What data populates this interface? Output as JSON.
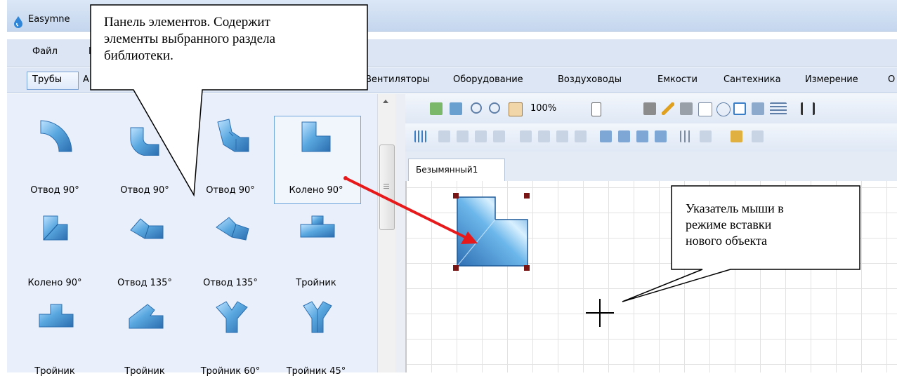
{
  "window": {
    "title_partial": "Easymne"
  },
  "menu": {
    "file": "Файл",
    "partial": "П"
  },
  "categories": {
    "active": "Трубы",
    "partial": "А",
    "items": [
      {
        "label": "Вентиляторы"
      },
      {
        "label": "Оборудование"
      },
      {
        "label": "Воздуховоды"
      },
      {
        "label": "Емкости"
      },
      {
        "label": "Сантехника"
      },
      {
        "label": "Измерение"
      },
      {
        "label": "О"
      }
    ]
  },
  "library_items": [
    {
      "label": "Отвод 90°",
      "icon": "bend-90-arc-icon"
    },
    {
      "label": "Отвод 90°",
      "icon": "bend-90-icon"
    },
    {
      "label": "Отвод 90°",
      "icon": "bend-90-segmented-icon"
    },
    {
      "label": "Колено 90°",
      "icon": "elbow-90-icon",
      "selected": true
    },
    {
      "label": "Колено 90°",
      "icon": "elbow-90-diagonal-icon"
    },
    {
      "label": "Отвод 135°",
      "icon": "bend-135-icon"
    },
    {
      "label": "Отвод 135°",
      "icon": "bend-135-alt-icon"
    },
    {
      "label": "Тройник",
      "icon": "tee-down-icon"
    },
    {
      "label": "Тройник",
      "icon": "tee-up-icon"
    },
    {
      "label": "Тройник",
      "icon": "tee-angled-icon"
    },
    {
      "label": "Тройник 60°",
      "icon": "wye-60-icon"
    },
    {
      "label": "Тройник 45°",
      "icon": "wye-45-icon"
    }
  ],
  "toolbar": {
    "zoom": "100%"
  },
  "document_tab": "Безымянный1",
  "callouts": {
    "panel": [
      "Панель элементов. Содержит",
      "элементы выбранного раздела",
      "библиотеки."
    ],
    "cursor": [
      "Указатель мыши в",
      "режиме вставки",
      "нового объекта"
    ]
  },
  "colors": {
    "accent_arrow": "#e8191b",
    "element_blue": "#5aa8e0",
    "handle": "#7a1515"
  }
}
